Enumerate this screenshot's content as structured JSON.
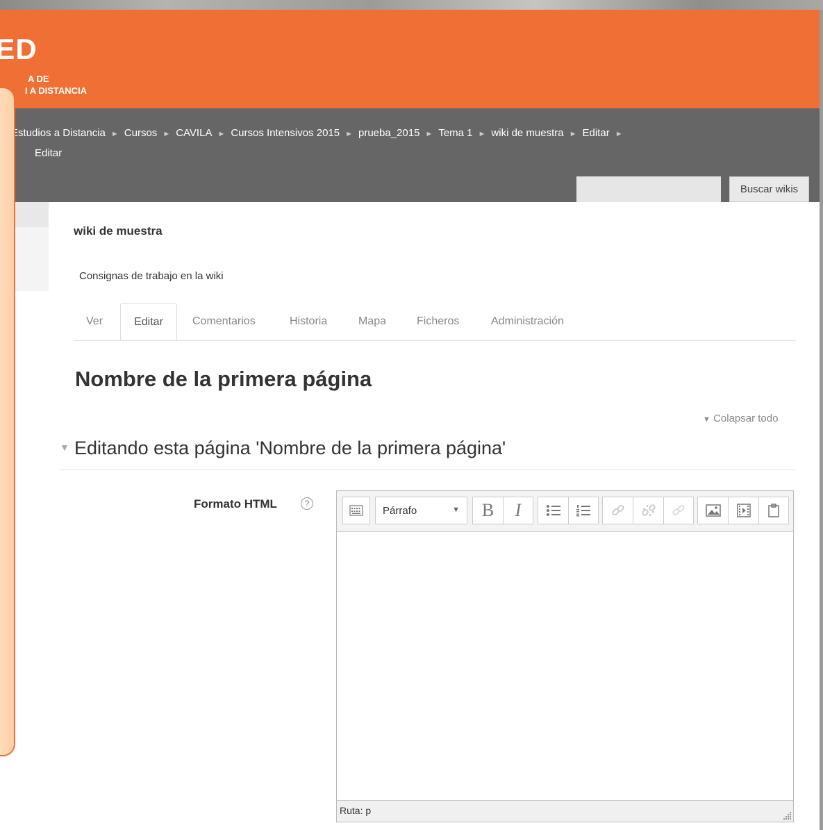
{
  "header": {
    "logo_main": "DED",
    "logo_line1": "A DE",
    "logo_line2": "I A DISTANCIA",
    "brand_color": "#f06f35"
  },
  "breadcrumb": {
    "items": [
      "Estudios a Distancia",
      "Cursos",
      "CAVILA",
      "Cursos Intensivos 2015",
      "prueba_2015",
      "Tema 1",
      "wiki de muestra",
      "Editar",
      "Editar"
    ],
    "separator": "►"
  },
  "search": {
    "placeholder": "",
    "button_label": "Buscar wikis"
  },
  "wiki": {
    "title": "wiki de muestra",
    "description": "Consignas de trabajo en la wiki"
  },
  "tabs": [
    {
      "label": "Ver",
      "active": false
    },
    {
      "label": "Editar",
      "active": true
    },
    {
      "label": "Comentarios",
      "active": false
    },
    {
      "label": "Historia",
      "active": false
    },
    {
      "label": "Mapa",
      "active": false
    },
    {
      "label": "Ficheros",
      "active": false
    },
    {
      "label": "Administración",
      "active": false
    }
  ],
  "page": {
    "heading": "Nombre de la primera página",
    "collapse_all": "Colapsar todo",
    "section_title": "Editando esta página 'Nombre de la primera página'"
  },
  "form": {
    "format_label": "Formato HTML",
    "help_icon": "?"
  },
  "editor": {
    "paragraph_format": "Párrafo",
    "status_path": "Ruta: p",
    "toolbar_icons": [
      "toolbar-toggle-icon",
      "bold-icon",
      "italic-icon",
      "bullet-list-icon",
      "numbered-list-icon",
      "link-icon",
      "unlink-icon",
      "anchor-icon",
      "image-icon",
      "media-icon",
      "paste-icon"
    ],
    "bold_glyph": "B",
    "italic_glyph": "I"
  }
}
